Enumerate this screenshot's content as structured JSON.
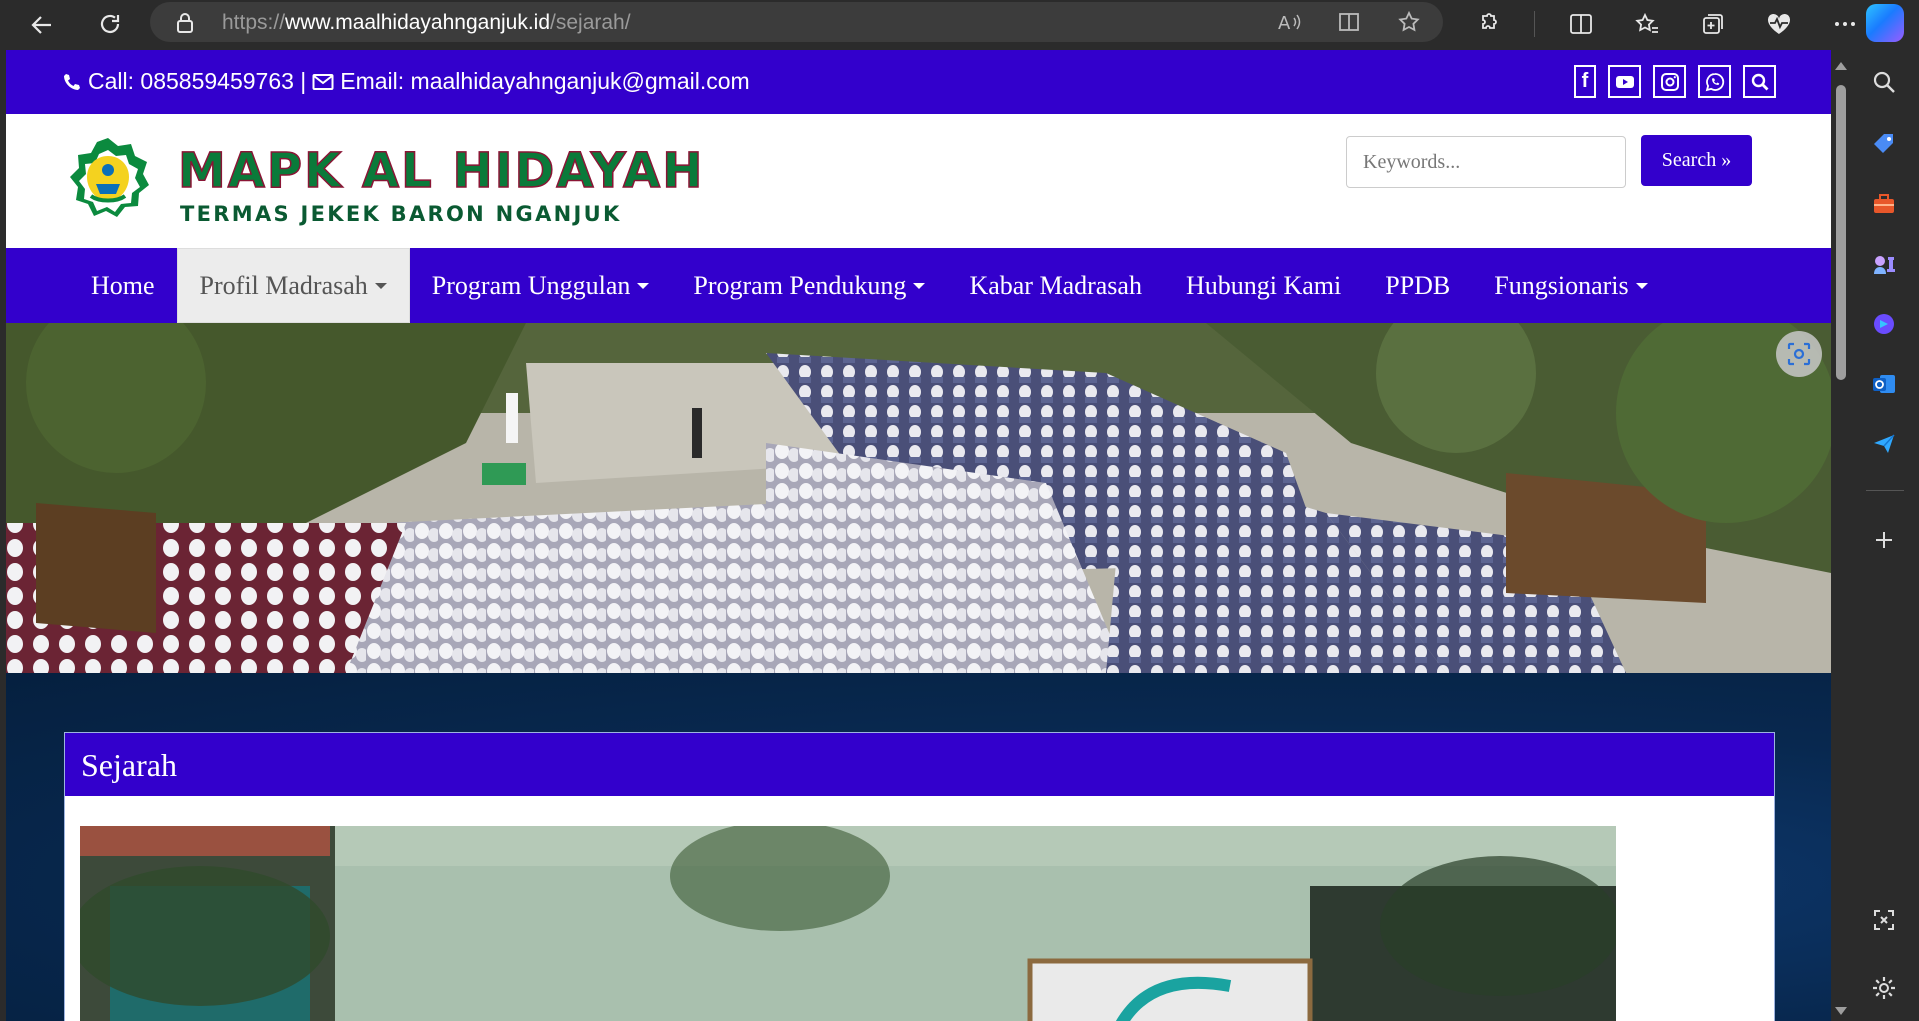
{
  "browser": {
    "url_prefix": "https://",
    "url_host": "www.maalhidayahnganjuk.id",
    "url_path": "/sejarah/"
  },
  "topbar": {
    "contact_text": "Call: 085859459763 | ",
    "email_text": "Email: maalhidayahnganjuk@gmail.com",
    "social": [
      "facebook-icon",
      "youtube-icon",
      "instagram-icon",
      "whatsapp-icon",
      "search-icon"
    ]
  },
  "header": {
    "logo_title": "MAPK AL HIDAYAH",
    "logo_subtitle": "TERMAS JEKEK BARON NGANJUK",
    "search_placeholder": "Keywords...",
    "search_button": "Search »"
  },
  "nav": {
    "items": [
      {
        "label": "Home",
        "dropdown": false,
        "active": false
      },
      {
        "label": "Profil Madrasah",
        "dropdown": true,
        "active": true
      },
      {
        "label": "Program Unggulan",
        "dropdown": true,
        "active": false
      },
      {
        "label": "Program Pendukung",
        "dropdown": true,
        "active": false
      },
      {
        "label": "Kabar Madrasah",
        "dropdown": false,
        "active": false
      },
      {
        "label": "Hubungi Kami",
        "dropdown": false,
        "active": false
      },
      {
        "label": "PPDB",
        "dropdown": false,
        "active": false
      },
      {
        "label": "Fungsionaris",
        "dropdown": true,
        "active": false
      }
    ]
  },
  "main": {
    "panel_title": "Sejarah"
  },
  "colors": {
    "brand": "#3300cc",
    "logo_green": "#0a7a3a",
    "logo_maroon": "#8a1535",
    "content_bg": "#08284f"
  }
}
